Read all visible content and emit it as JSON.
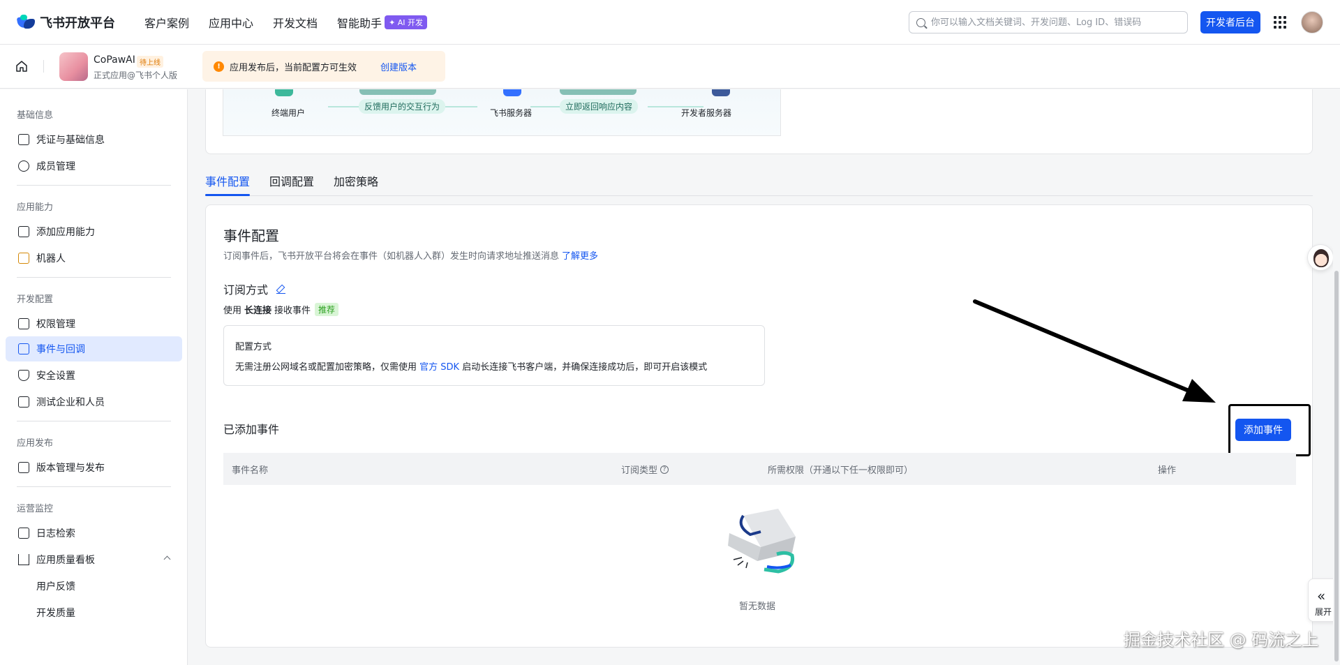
{
  "topbar": {
    "logo_text": "飞书开放平台",
    "nav": [
      "客户案例",
      "应用中心",
      "开发文档",
      "智能助手"
    ],
    "ai_badge": "✦ AI 开发",
    "search_placeholder": "你可以输入文档关键词、开发问题、Log ID、错误码",
    "dev_button": "开发者后台"
  },
  "subbar": {
    "app_name": "CoPawAI",
    "app_status": "待上线",
    "app_sub": "正式应用@飞书个人版",
    "notice_text": "应用发布后，当前配置方可生效",
    "notice_link": "创建版本"
  },
  "sidebar": {
    "sections": [
      {
        "title": "基础信息",
        "items": [
          "凭证与基础信息",
          "成员管理"
        ]
      },
      {
        "title": "应用能力",
        "items": [
          "添加应用能力",
          "机器人"
        ]
      },
      {
        "title": "开发配置",
        "items": [
          "权限管理",
          "事件与回调",
          "安全设置",
          "测试企业和人员"
        ]
      },
      {
        "title": "应用发布",
        "items": [
          "版本管理与发布"
        ]
      },
      {
        "title": "运营监控",
        "items": [
          "日志检索",
          "应用质量看板",
          "用户反馈",
          "开发质量"
        ]
      }
    ]
  },
  "flow": {
    "nodes": [
      "终端用户",
      "飞书服务器",
      "开发者服务器"
    ],
    "pills": [
      "反馈用户的交互行为",
      "立即返回响应内容"
    ]
  },
  "tabs": [
    "事件配置",
    "回调配置",
    "加密策略"
  ],
  "panel": {
    "title": "事件配置",
    "desc": "订阅事件后，飞书开放平台将会在事件（如机器人入群）发生时向请求地址推送消息",
    "desc_link": "了解更多",
    "sub_title": "订阅方式",
    "mode_prefix": "使用",
    "mode_bold": "长连接",
    "mode_suffix": "接收事件",
    "mode_tag": "推荐",
    "cfg_title": "配置方式",
    "cfg_text_a": "无需注册公网域名或配置加密策略，仅需使用",
    "cfg_link": "官方 SDK",
    "cfg_text_b": "启动长连接飞书客户端，并确保连接成功后，即可开启该模式",
    "added_title": "已添加事件",
    "add_button": "添加事件",
    "columns": [
      "事件名称",
      "订阅类型",
      "所需权限（开通以下任一权限即可）",
      "操作"
    ],
    "empty_text": "暂无数据"
  },
  "float": {
    "expand_label": "展开",
    "expand_chevron": "«"
  },
  "watermark": "掘金技术社区 @ 码流之上"
}
